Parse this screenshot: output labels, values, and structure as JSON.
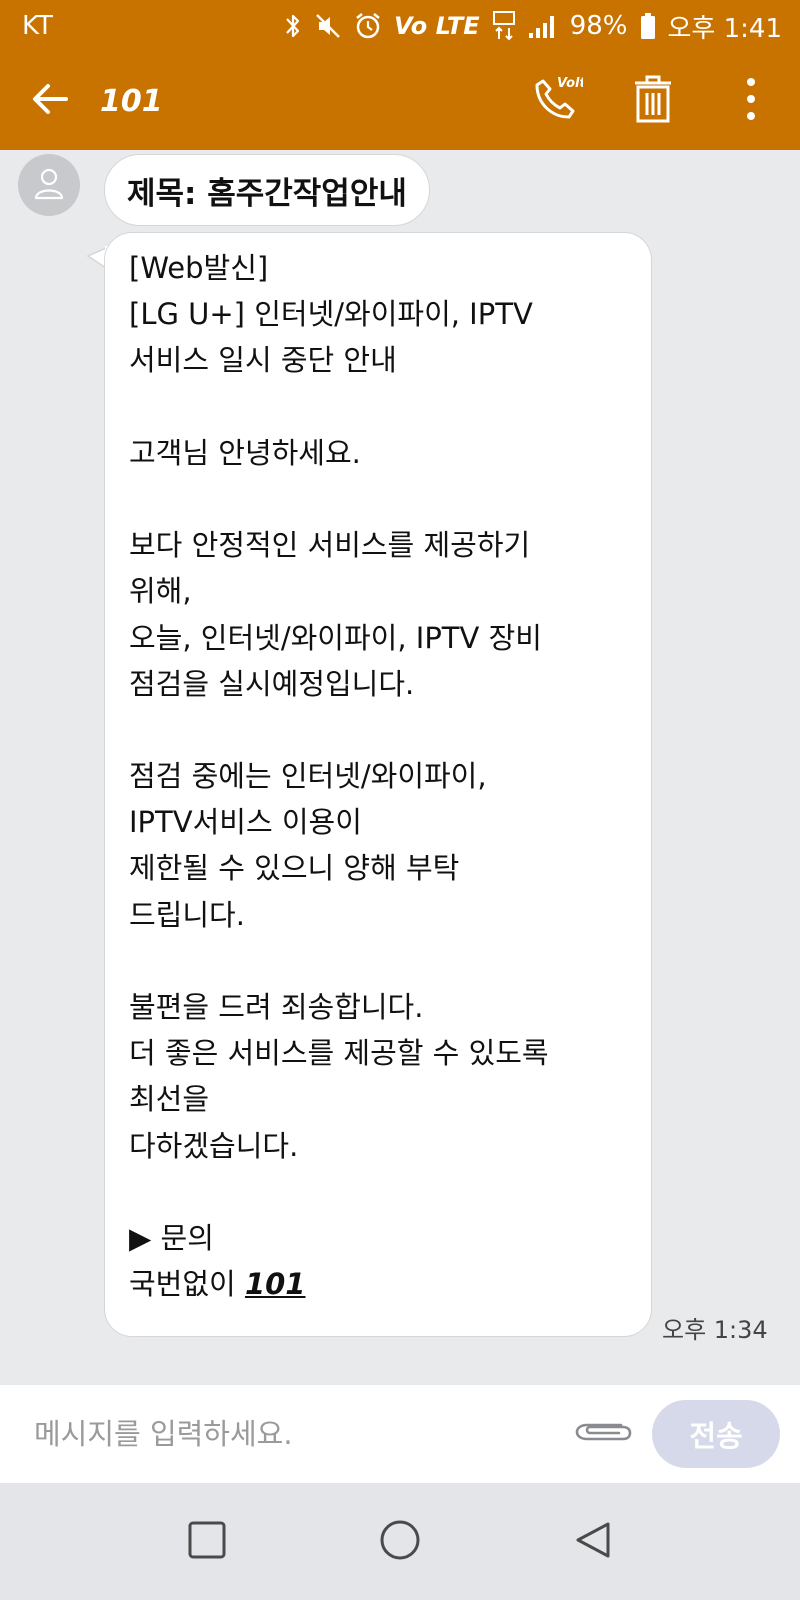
{
  "status_bar": {
    "carrier": "KT",
    "lte_label": "Vo LTE",
    "battery_percent": "98%",
    "time": "오후 1:41",
    "icons": [
      "bluetooth-icon",
      "mute-icon",
      "alarm-icon",
      "volte-icon",
      "data-lte-icon",
      "signal-icon",
      "battery-icon"
    ]
  },
  "header": {
    "title": "101",
    "icons": [
      "back-arrow-icon",
      "volte-call-icon",
      "trash-icon",
      "more-vert-icon"
    ]
  },
  "conversation": {
    "subject": "제목: 홈주간작업안내",
    "message_lines": [
      "[Web발신]",
      "[LG U+] 인터넷/와이파이, IPTV",
      "서비스 일시 중단 안내",
      "",
      "고객님 안녕하세요.",
      "",
      "보다 안정적인 서비스를 제공하기",
      "위해,",
      "오늘, 인터넷/와이파이, IPTV 장비",
      "점검을 실시예정입니다.",
      "",
      "점검 중에는 인터넷/와이파이,",
      "IPTV서비스 이용이",
      "제한될 수 있으니 양해 부탁",
      "드립니다.",
      "",
      "불편을 드려 죄송합니다.",
      "더 좋은 서비스를 제공할 수 있도록",
      "최선을",
      "다하겠습니다.",
      "",
      "▶ 문의"
    ],
    "inquiry_prefix": "국번없이 ",
    "inquiry_number": "101",
    "timestamp": "오후 1:34"
  },
  "composer": {
    "placeholder": "메시지를 입력하세요.",
    "send_label": "전송"
  },
  "colors": {
    "accent": "#c87200",
    "chat_bg": "#e9eaec",
    "send_button": "#d6d9e9"
  },
  "nav": {
    "icons": [
      "recent-apps-icon",
      "home-icon",
      "back-icon"
    ]
  }
}
